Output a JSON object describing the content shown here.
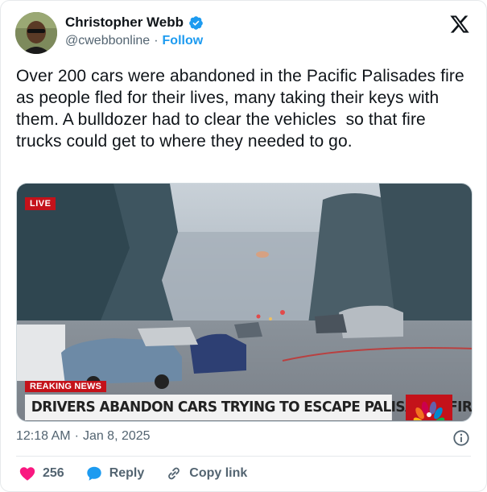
{
  "author": {
    "name": "Christopher Webb",
    "handle": "@cwebbonline",
    "separator": "·",
    "follow_label": "Follow"
  },
  "tweet": {
    "text": "Over 200 cars were abandoned in the Pacific Palisades fire as people fled for their lives, many taking their keys with them. A bulldozer had to clear the vehicles  so that fire trucks could get to where they needed to go."
  },
  "media": {
    "live_label": "LIVE",
    "breaking_label": "REAKING NEWS",
    "chyron": "DRIVERS ABANDON CARS TRYING TO ESCAPE PALISADES FIRE"
  },
  "meta": {
    "time": "12:18 AM",
    "separator": "·",
    "date": "Jan 8, 2025"
  },
  "actions": {
    "like_count": "256",
    "reply_label": "Reply",
    "copy_link_label": "Copy link"
  },
  "colors": {
    "accent": "#1d9bf0",
    "like": "#f91880",
    "breaking_red": "#c4121a"
  },
  "icons": [
    "verified-badge-icon",
    "x-logo-icon",
    "info-icon",
    "heart-icon",
    "reply-bubble-icon",
    "link-icon",
    "nbc-peacock-icon"
  ]
}
